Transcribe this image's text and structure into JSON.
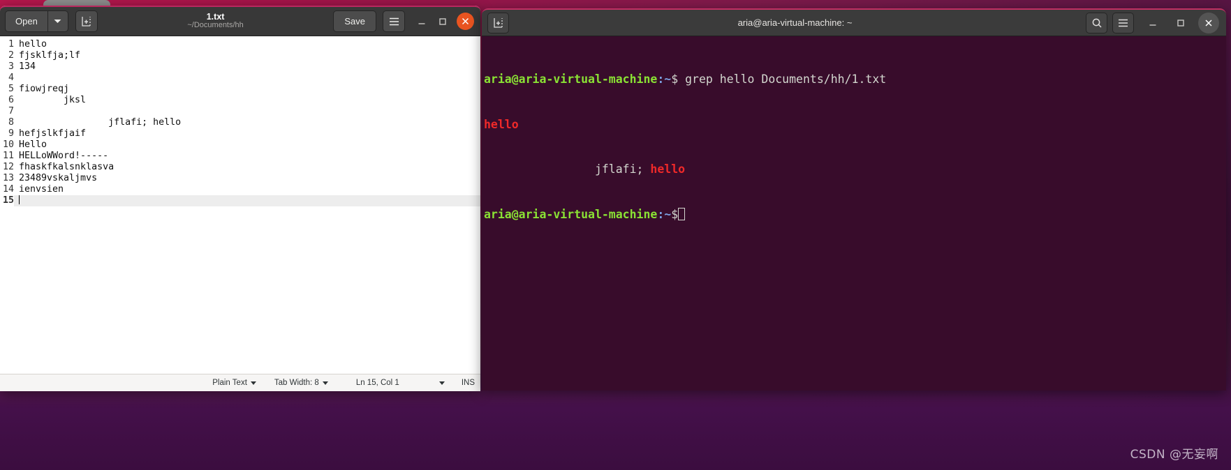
{
  "desktop": {
    "watermark": "CSDN @无妄啊",
    "background_color": "#4b1440"
  },
  "gedit": {
    "window_title": "1.txt",
    "window_subtitle": "~/Documents/hh",
    "toolbar": {
      "open_label": "Open",
      "open_dropdown_icon": "chevron-down-icon",
      "new_document_icon": "new-document-icon",
      "save_label": "Save",
      "menu_icon": "hamburger-menu-icon"
    },
    "window_controls": {
      "minimize_icon": "minimize-icon",
      "maximize_icon": "maximize-icon",
      "close_icon": "close-icon"
    },
    "document": {
      "lines": [
        {
          "number": "1",
          "text": "hello"
        },
        {
          "number": "2",
          "text": "fjsklfja;lf"
        },
        {
          "number": "3",
          "text": "134"
        },
        {
          "number": "4",
          "text": ""
        },
        {
          "number": "5",
          "text": "fiowjreqj"
        },
        {
          "number": "6",
          "text": "        jksl"
        },
        {
          "number": "7",
          "text": ""
        },
        {
          "number": "8",
          "text": "                jflafi; hello"
        },
        {
          "number": "9",
          "text": "hefjslkfjaif"
        },
        {
          "number": "10",
          "text": "Hello"
        },
        {
          "number": "11",
          "text": "HELLoWWord!-----"
        },
        {
          "number": "12",
          "text": "fhaskfkalsnklasva"
        },
        {
          "number": "13",
          "text": "23489vskaljmvs"
        },
        {
          "number": "14",
          "text": "ienvsien"
        },
        {
          "number": "15",
          "text": ""
        }
      ],
      "current_line_number": "15"
    },
    "statusbar": {
      "language": "Plain Text",
      "tab_width": "Tab Width: 8",
      "cursor_position": "Ln 15, Col 1",
      "insert_mode": "INS"
    }
  },
  "terminal": {
    "window_title": "aria@aria-virtual-machine: ~",
    "toolbar": {
      "new_tab_icon": "new-tab-icon",
      "search_icon": "search-icon",
      "menu_icon": "hamburger-menu-icon"
    },
    "window_controls": {
      "minimize_icon": "minimize-icon",
      "maximize_icon": "maximize-icon",
      "close_icon": "close-icon"
    },
    "colors": {
      "background": "#380c2b",
      "prompt_user": "#8ae234",
      "prompt_host": "#cece3f",
      "prompt_path": "#7b9fe0",
      "text": "#d3d7cf",
      "match": "#ef2929"
    },
    "session": {
      "prompt_user_host": "aria@aria-virtual-machine",
      "prompt_path": ":~",
      "prompt_symbol": "$",
      "command": "grep hello Documents/hh/1.txt",
      "output_line_1_match": "hello",
      "output_line_2_prefix": "                jflafi; ",
      "output_line_2_match": "hello"
    }
  }
}
